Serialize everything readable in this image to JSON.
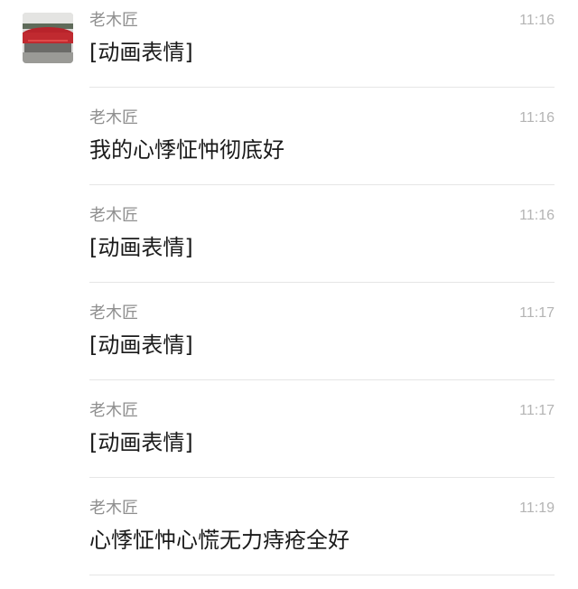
{
  "messages": [
    {
      "sender": "老木匠",
      "time": "11:16",
      "text": "[动画表情]"
    },
    {
      "sender": "老木匠",
      "time": "11:16",
      "text": "我的心悸怔忡彻底好"
    },
    {
      "sender": "老木匠",
      "time": "11:16",
      "text": "[动画表情]"
    },
    {
      "sender": "老木匠",
      "time": "11:17",
      "text": "[动画表情]"
    },
    {
      "sender": "老木匠",
      "time": "11:17",
      "text": "[动画表情]"
    },
    {
      "sender": "老木匠",
      "time": "11:19",
      "text": "心悸怔忡心慌无力痔疮全好"
    }
  ]
}
